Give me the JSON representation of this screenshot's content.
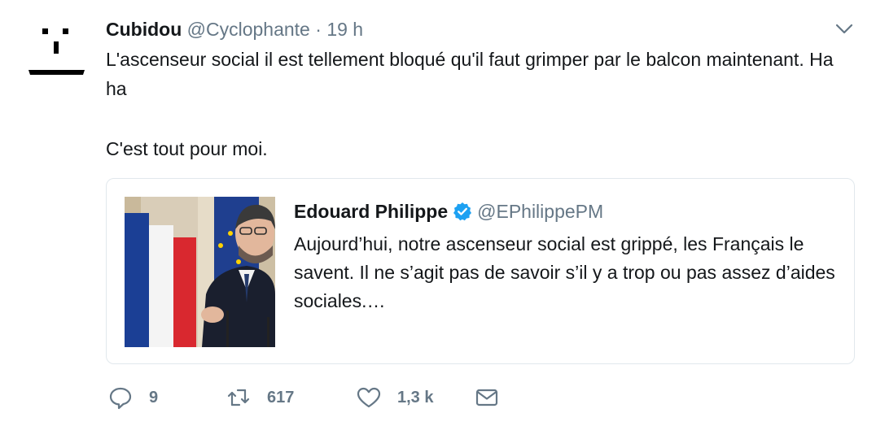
{
  "tweet": {
    "author_name": "Cubidou",
    "author_handle": "@Cyclophante",
    "separator": "·",
    "time": "19 h",
    "text_line1": "L'ascenseur social il est tellement bloqué qu'il faut grimper par le balcon maintenant. Ha ha",
    "text_line2": "C'est tout pour moi."
  },
  "quote": {
    "name": "Edouard Philippe",
    "handle": "@EPhilippePM",
    "text": "Aujourd’hui, notre ascenseur social est grippé, les Français le savent. Il ne s’agit pas de savoir s’il y a trop ou pas assez d’aides sociales.…",
    "verified": true
  },
  "actions": {
    "replies": "9",
    "retweets": "617",
    "likes": "1,3 k"
  },
  "icons": {
    "avatar": "face-icon",
    "caret": "chevron-down-icon",
    "verified": "verified-badge-icon",
    "reply": "reply-icon",
    "retweet": "retweet-icon",
    "like": "heart-icon",
    "dm": "envelope-icon"
  },
  "colors": {
    "text": "#14171a",
    "secondary": "#657786",
    "verified": "#1da1f2",
    "border": "#e1e8ed"
  }
}
